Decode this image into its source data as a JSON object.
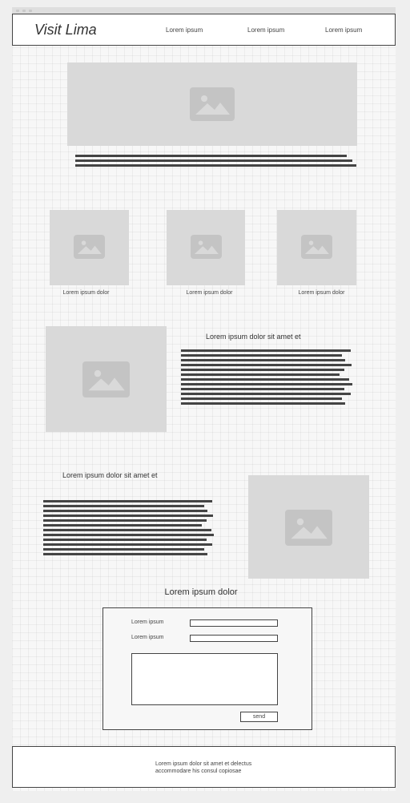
{
  "header": {
    "logo": "Visit Lima",
    "nav": [
      "Lorem ipsum",
      "Lorem ipsum",
      "Lorem ipsum"
    ]
  },
  "gallery": {
    "captions": [
      "Lorem ipsum dolor",
      "Lorem ipsum dolor",
      "Lorem ipsum dolor"
    ]
  },
  "section_one": {
    "heading": "Lorem ipsum dolor sit amet et"
  },
  "section_two": {
    "heading": "Lorem ipsum dolor sit amet et"
  },
  "contact": {
    "title": "Lorem ipsum dolor",
    "field1_label": "Lorem ipsum",
    "field2_label": "Lorem ipsum",
    "field1_value": "",
    "field2_value": "",
    "message_value": "",
    "send_label": "send"
  },
  "footer": {
    "line1": "Lorem ipsum dolor sit amet et delectus",
    "line2": "accommodare his consul copiosae"
  },
  "icons": [
    "image-placeholder-icon"
  ]
}
